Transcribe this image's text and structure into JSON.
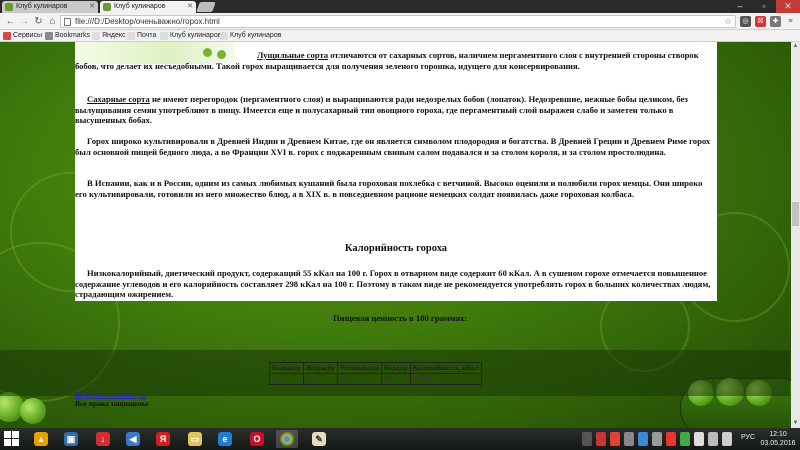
{
  "browser": {
    "tabs": [
      {
        "label": "Клуб кулинаров"
      },
      {
        "label": "Клуб кулинаров"
      }
    ],
    "address": "file:///D:/Desktop/оченьважно/горох.html",
    "bookmarks": [
      {
        "label": "Сервисы",
        "icon": "apps-icon",
        "color": "#d44"
      },
      {
        "label": "Bookmarks",
        "icon": "star-icon",
        "color": "#888"
      },
      {
        "label": "Яндекс",
        "icon": "page-icon",
        "color": "#ddd"
      },
      {
        "label": "Почта",
        "icon": "page-icon",
        "color": "#ddd"
      },
      {
        "label": "Клуб кулинаров",
        "icon": "page-icon",
        "color": "#ddd"
      },
      {
        "label": "Клуб кулинаров",
        "icon": "page-icon",
        "color": "#ddd"
      }
    ]
  },
  "page": {
    "p1_link": "Лущильные сорта",
    "p1_text": " отличаются от сахарных сортов, наличием пергаментного слоя с внутренней стороны створок бобов, что делает их несъедобными. Такой горох выращивается для получения зеленого горошка, идущего для консервирования.",
    "p2_link": "Сахарные сорта",
    "p2_text": " не имеют перегородок (пергаментного слоя) и выращиваются ради недозрелых бобов (лопаток). Недозревшие, нежные бобы целиком, без вылущивания семян употребляют в пищу. Имеется еще и полусахарный тип овощного гороха, где пергаментный слой выражен слабо и заметен только в высушенных бобах.",
    "p3": "Горох широко культивировали в Древней Индии и Древнем Китае, где он является символом плодородия и богатства. В Древней Греции и Древнем Риме горох был основной пищей бедного люда, а во Франции XVI в. горох с поджаренным свиным салом подавался и за столом короля, и за столом простолюдина.",
    "p4": "В Испании, как и в России, одним из самых любимых кушаний была гороховая похлебка с ветчиной. Высоко оценили и полюбили горох немцы. Они широко его культивировали, готовили из него множество блюд, а в XIX в. в повседневном рационе немецких солдат появилась даже гороховая колбаса.",
    "cal_heading": "Калорийность гороха",
    "p5": "Низкокалорийный, диетический продукт, содержащий 55 кКал на 100 г. Горох в отварном виде содержит 60 кКал. А в сушеном горохе отмечается повышенное содержание углеводов и его калорийность составляет 298 кКал на 100 г. Поэтому в таком виде не рекомендуется употреблять горох в больших количествах людям, страдающим ожирением.",
    "nutri_title": "Пищевая ценность в 100 граммах:",
    "table": {
      "headers": [
        "Белки,гр",
        "Жиры,гр",
        "Углеводы,гр",
        "Вода,гр",
        "Калорийность, кКал"
      ],
      "row": [
        "5",
        "0.2",
        "8.4",
        "80",
        "55-298"
      ]
    },
    "link_bottom": "Вернуться на главную",
    "small_bottom": "Все права защищены"
  },
  "taskbar": {
    "lang": "РУС",
    "time": "12:10",
    "date": "03.05.2016"
  }
}
